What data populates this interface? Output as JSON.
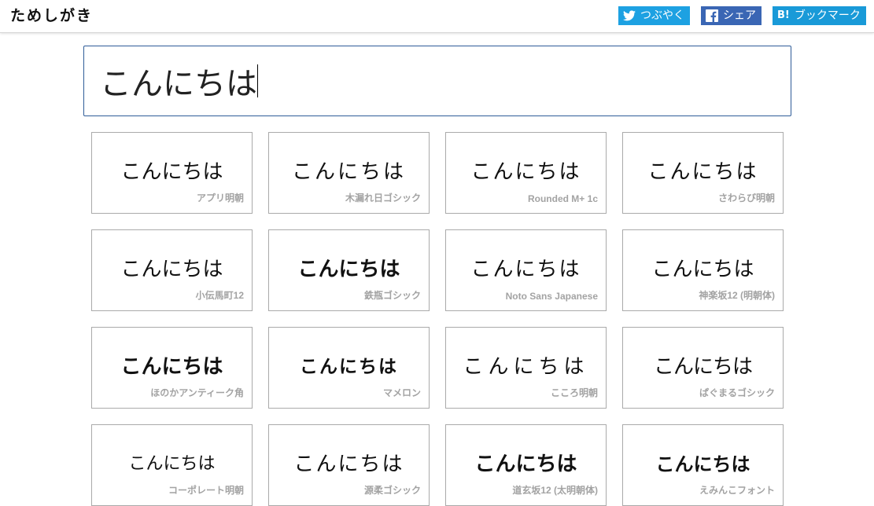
{
  "app": {
    "logo": "ためしがき"
  },
  "share": {
    "twitter_label": "つぶやく",
    "facebook_label": "シェア",
    "hatena_mark": "B!",
    "hatena_label": "ブックマーク"
  },
  "input": {
    "value": "こんにちは"
  },
  "fonts": [
    {
      "sample": "こんにちは",
      "name": "アプリ明朝"
    },
    {
      "sample": "こんにちは",
      "name": "木漏れ日ゴシック"
    },
    {
      "sample": "こんにちは",
      "name": "Rounded M+ 1c"
    },
    {
      "sample": "こんにちは",
      "name": "さわらび明朝"
    },
    {
      "sample": "こんにちは",
      "name": "小伝馬町12"
    },
    {
      "sample": "こんにちは",
      "name": "鉄瓶ゴシック"
    },
    {
      "sample": "こんにちは",
      "name": "Noto Sans Japanese"
    },
    {
      "sample": "こんにちは",
      "name": "神楽坂12 (明朝体)"
    },
    {
      "sample": "こんにちは",
      "name": "ほのかアンティーク角"
    },
    {
      "sample": "こんにちは",
      "name": "マメロン"
    },
    {
      "sample": "こんにちは",
      "name": "こころ明朝"
    },
    {
      "sample": "こんにちは",
      "name": "ぱぐまるゴシック"
    },
    {
      "sample": "こんにちは",
      "name": "コーポレート明朝"
    },
    {
      "sample": "こんにちは",
      "name": "源柔ゴシック"
    },
    {
      "sample": "こんにちは",
      "name": "道玄坂12 (太明朝体)"
    },
    {
      "sample": "こんにちは",
      "name": "えみんこフォント"
    }
  ],
  "colors": {
    "twitter": "#1da1e2",
    "facebook": "#3a66b4",
    "hatena": "#199ad8",
    "input_border": "#2f5c98",
    "font_name": "#a3a3a3"
  }
}
